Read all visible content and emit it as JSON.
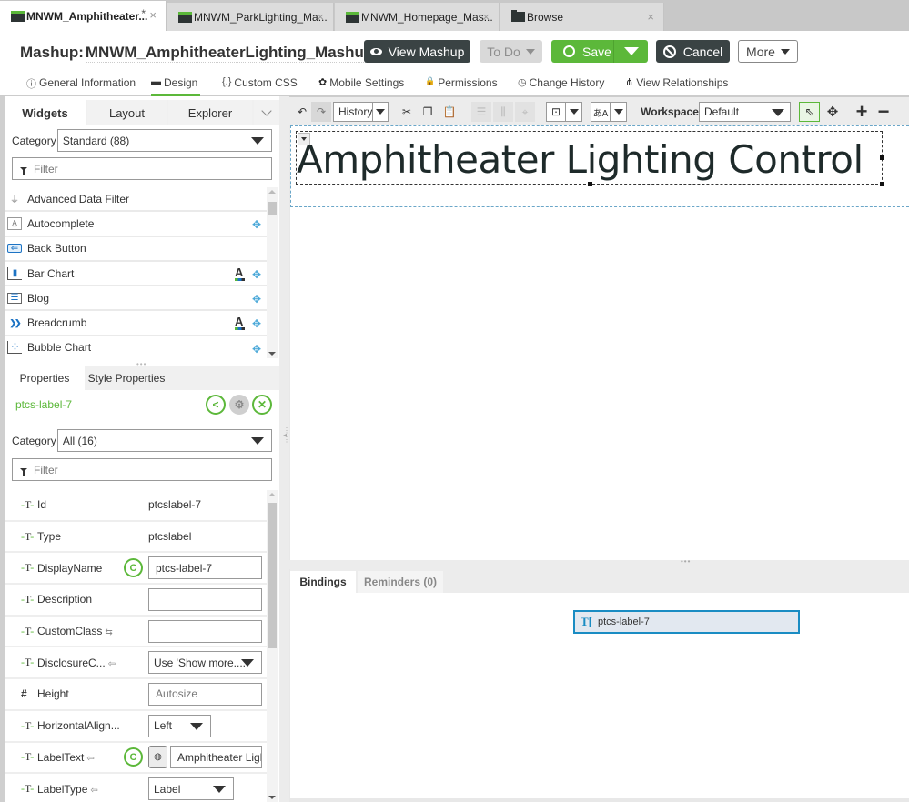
{
  "tabs": [
    {
      "label": "MNWM_Amphitheater...",
      "modified": "*",
      "icon": "mashup-icon",
      "active": true
    },
    {
      "label": "MNWM_ParkLighting_Ma...",
      "icon": "mashup-icon",
      "active": false
    },
    {
      "label": "MNWM_Homepage_Mas...",
      "icon": "mashup-icon",
      "active": false
    },
    {
      "label": "Browse",
      "icon": "folder-icon",
      "active": false
    }
  ],
  "close_glyph": "×",
  "header": {
    "entity_type": "Mashup:",
    "entity_name": "MNWM_AmphitheaterLighting_Mashup",
    "modified": "*",
    "help": "?",
    "buttons": {
      "view_mashup": "View Mashup",
      "todo": "To Do",
      "save": "Save",
      "cancel": "Cancel",
      "more": "More"
    }
  },
  "subnav": [
    {
      "label": "General Information",
      "icon": "ⓘ"
    },
    {
      "label": "Design",
      "icon": "▬",
      "active": true
    },
    {
      "label": "Custom CSS",
      "icon": "{.}"
    },
    {
      "label": "Mobile Settings",
      "icon": "✿"
    },
    {
      "label": "Permissions",
      "icon": "🔒"
    },
    {
      "label": "Change History",
      "icon": "◷"
    },
    {
      "label": "View Relationships",
      "icon": "⋔"
    }
  ],
  "widgets_panel": {
    "tabs": [
      "Widgets",
      "Layout",
      "Explorer"
    ],
    "category_label": "Category",
    "category_value": "Standard (88)",
    "filter_placeholder": "Filter",
    "items": [
      {
        "label": "Advanced Data Filter",
        "icon": "⏚",
        "font": false,
        "drag": false
      },
      {
        "label": "Autocomplete",
        "icon": "A̲",
        "font": false,
        "drag": true
      },
      {
        "label": "Back Button",
        "icon": "⇐",
        "font": false,
        "drag": false
      },
      {
        "label": "Bar Chart",
        "icon": "▮",
        "font": true,
        "drag": true
      },
      {
        "label": "Blog",
        "icon": "☰",
        "font": false,
        "drag": true
      },
      {
        "label": "Breadcrumb",
        "icon": "❯❯",
        "font": true,
        "drag": true
      },
      {
        "label": "Bubble Chart",
        "icon": "⁘",
        "font": false,
        "drag": true
      }
    ],
    "font_glyph": "A",
    "drag_glyph": "✥"
  },
  "properties_panel": {
    "tabs": [
      "Properties",
      "Style Properties"
    ],
    "selected_widget": "ptcs-label-7",
    "category_label": "Category",
    "category_value": "All (16)",
    "filter_placeholder": "Filter",
    "rows": [
      {
        "type": "T",
        "name": "Id",
        "value": "ptcslabel-7"
      },
      {
        "type": "T",
        "name": "Type",
        "value": "ptcslabel"
      },
      {
        "type": "T",
        "name": "DisplayName",
        "value": "ptcs-label-7"
      },
      {
        "type": "T",
        "name": "Description",
        "value": ""
      },
      {
        "type": "T",
        "name": "CustomClass",
        "value": ""
      },
      {
        "type": "T",
        "name": "DisclosureC...",
        "value": "Use 'Show more....."
      },
      {
        "type": "#",
        "name": "Height",
        "placeholder": "Autosize"
      },
      {
        "type": "T",
        "name": "HorizontalAlign...",
        "value": "Left"
      },
      {
        "type": "T",
        "name": "LabelText",
        "value": "Amphitheater Ligh"
      },
      {
        "type": "T",
        "name": "LabelType",
        "value": "Label"
      }
    ]
  },
  "toolbar": {
    "history_label": "History",
    "workspace_label": "Workspace",
    "workspace_value": "Default"
  },
  "canvas": {
    "label_text": "Amphitheater Lighting Control"
  },
  "bottom_panel": {
    "tabs": [
      "Bindings",
      "Reminders (0)"
    ],
    "binding_node": "ptcs-label-7"
  },
  "colors": {
    "accent_green": "#5cb83a",
    "dark_button": "#3a4344",
    "binding_blue": "#1a8cc3"
  }
}
